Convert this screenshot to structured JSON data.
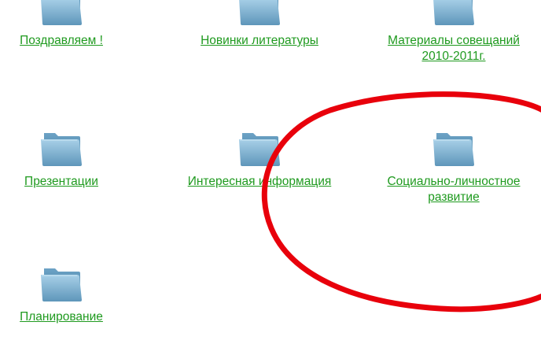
{
  "folders": [
    {
      "label": "Поздравляем !",
      "icon": "folder-icon"
    },
    {
      "label": "Новинки литературы",
      "icon": "folder-icon"
    },
    {
      "label": "Материалы совещаний 2010-2011г.",
      "icon": "folder-icon"
    },
    {
      "label": "Презентации",
      "icon": "folder-icon"
    },
    {
      "label": "Интересная информация",
      "icon": "folder-icon"
    },
    {
      "label": "Социально-личностное развитие",
      "icon": "folder-icon"
    },
    {
      "label": "Планирование",
      "icon": "folder-icon"
    }
  ],
  "colors": {
    "link": "#1f9a1f",
    "annotation": "#e8000b",
    "folder": "#7fb2cf"
  }
}
